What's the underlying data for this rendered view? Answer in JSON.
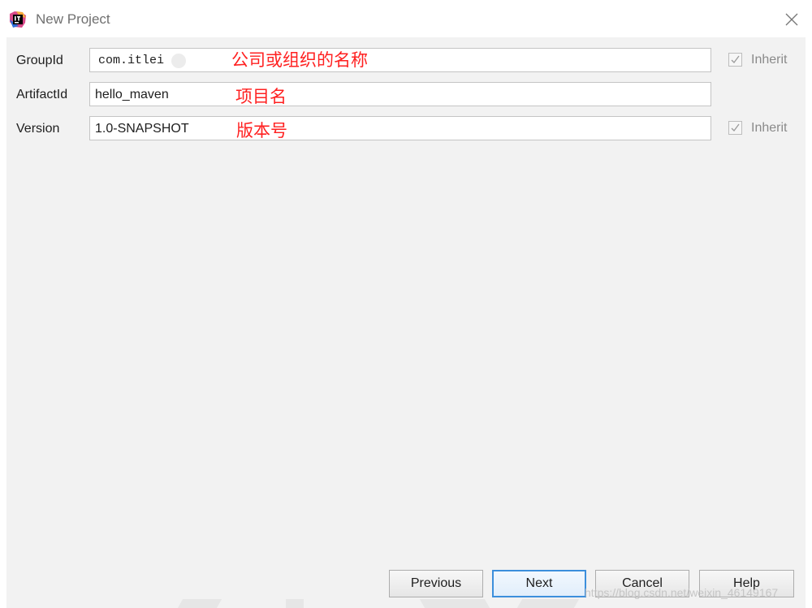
{
  "window": {
    "title": "New Project",
    "app_icon": "intellij-logo-icon",
    "close_icon": "close-icon"
  },
  "fields": [
    {
      "label": "GroupId",
      "value": "com.itlei",
      "annotation": "公司或组织的名称",
      "inherit": true
    },
    {
      "label": "ArtifactId",
      "value": "hello_maven",
      "annotation": "项目名",
      "inherit": null
    },
    {
      "label": "Version",
      "value": "1.0-SNAPSHOT",
      "annotation": "版本号",
      "inherit": true
    }
  ],
  "inherit_label": "Inherit",
  "buttons": {
    "previous": "Previous",
    "next": "Next",
    "cancel": "Cancel",
    "help": "Help"
  },
  "watermark": "https://blog.csdn.net/weixin_46149167",
  "colors": {
    "annotation": "#ff2020",
    "panel_background": "#f2f2f2",
    "primary_button_border": "#3c8fdc"
  }
}
